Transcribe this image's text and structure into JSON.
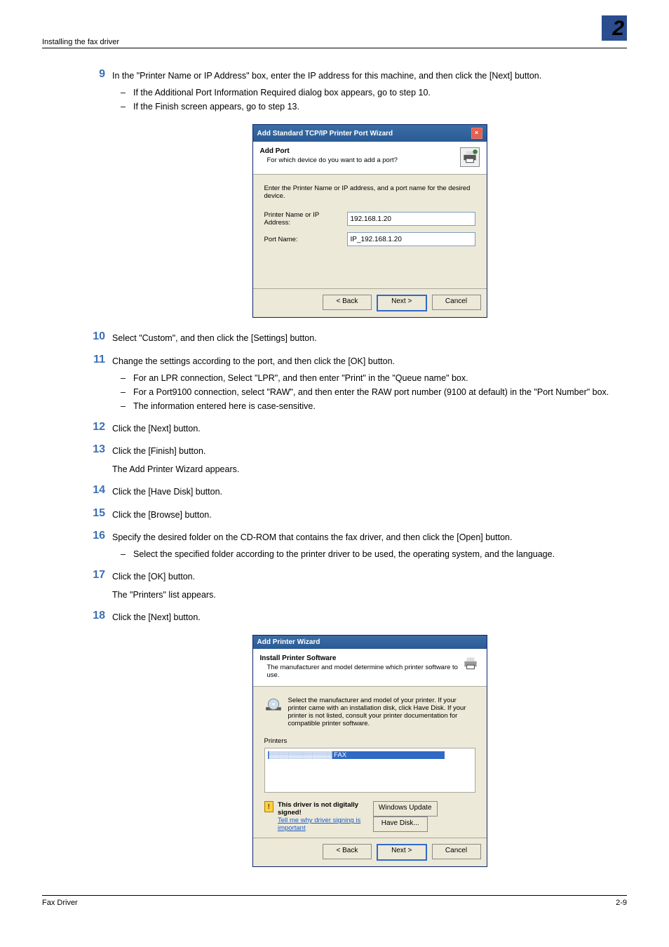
{
  "header": {
    "section_title": "Installing the fax driver",
    "chapter_number": "2"
  },
  "steps": {
    "s9": {
      "num": "9",
      "text": "In the \"Printer Name or IP Address\" box, enter the IP address for this machine, and then click the [Next] button.",
      "sub": [
        "If the Additional Port Information Required dialog box appears, go to step 10.",
        "If the Finish screen appears, go to step 13."
      ]
    },
    "s10": {
      "num": "10",
      "text": "Select \"Custom\", and then click the [Settings] button."
    },
    "s11": {
      "num": "11",
      "text": "Change the settings according to the port, and then click the [OK] button.",
      "sub": [
        "For an LPR connection, Select \"LPR\", and then enter \"Print\" in the \"Queue name\" box.",
        "For a Port9100 connection, select \"RAW\", and then enter the RAW port number (9100 at default) in the \"Port Number\" box.",
        "The information entered here is case-sensitive."
      ]
    },
    "s12": {
      "num": "12",
      "text": "Click the [Next] button."
    },
    "s13": {
      "num": "13",
      "text": "Click the [Finish] button.",
      "extra": "The Add Printer Wizard appears."
    },
    "s14": {
      "num": "14",
      "text": "Click the [Have Disk] button."
    },
    "s15": {
      "num": "15",
      "text": "Click the [Browse] button."
    },
    "s16": {
      "num": "16",
      "text": "Specify the desired folder on the CD-ROM that contains the fax driver, and then click the [Open] button.",
      "sub": [
        "Select the specified folder according to the printer driver to be used, the operating system, and the language."
      ]
    },
    "s17": {
      "num": "17",
      "text": "Click the [OK] button.",
      "extra": "The \"Printers\" list appears."
    },
    "s18": {
      "num": "18",
      "text": "Click the [Next] button."
    }
  },
  "dialog1": {
    "title": "Add Standard TCP/IP Printer Port Wizard",
    "head_bold": "Add Port",
    "head_sub": "For which device do you want to add a port?",
    "instruction": "Enter the Printer Name or IP address, and a port name for the desired device.",
    "label1": "Printer Name or IP Address:",
    "value1": "192.168.1.20",
    "label2": "Port Name:",
    "value2": "IP_192.168.1.20",
    "btn_back": "< Back",
    "btn_next": "Next >",
    "btn_cancel": "Cancel"
  },
  "dialog2": {
    "title": "Add Printer Wizard",
    "head_bold": "Install Printer Software",
    "head_sub": "The manufacturer and model determine which printer software to use.",
    "instruction": "Select the manufacturer and model of your printer. If your printer came with an installation disk, click Have Disk. If your printer is not listed, consult your printer documentation for compatible printer software.",
    "printers_label": "Printers",
    "printers_entry": "FAX",
    "warn_bold": "This driver is not digitally signed!",
    "warn_link": "Tell me why driver signing is important",
    "btn_wu": "Windows Update",
    "btn_hd": "Have Disk...",
    "btn_back": "< Back",
    "btn_next": "Next >",
    "btn_cancel": "Cancel"
  },
  "footer": {
    "left": "Fax Driver",
    "right": "2-9"
  }
}
